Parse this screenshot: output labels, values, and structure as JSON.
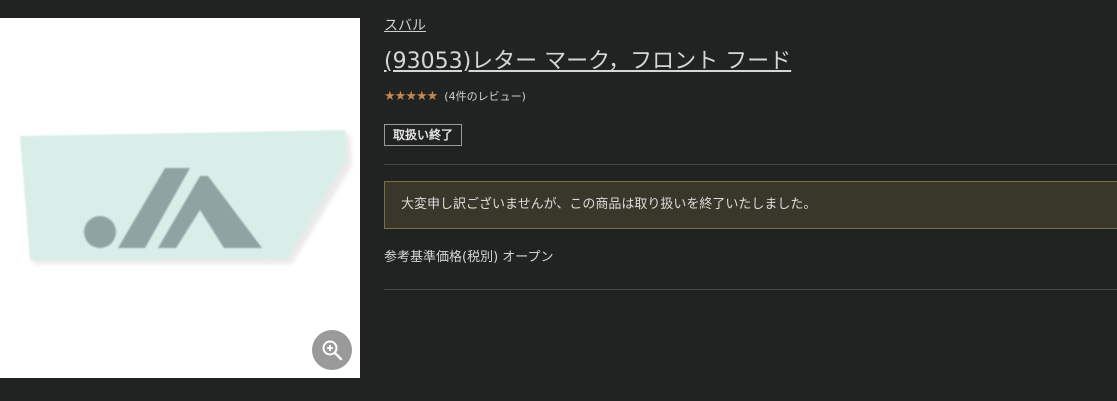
{
  "product_image": {
    "alt": "",
    "zoom_icon": "zoom-in-icon"
  },
  "product": {
    "brand": "スバル",
    "title": "(93053)レター マーク，フロント フード",
    "rating_stars": 5,
    "review_count_text": "(4件のレビュー)",
    "status_badge": "取扱い終了",
    "notice": "大変申し訳ございませんが、この商品は取り扱いを終了いたしました。",
    "price_text": "参考基準価格(税別) オープン"
  },
  "colors": {
    "background": "#212322",
    "star": "#c4884b",
    "notice_background": "#39362a",
    "notice_border": "#7b6f44"
  }
}
